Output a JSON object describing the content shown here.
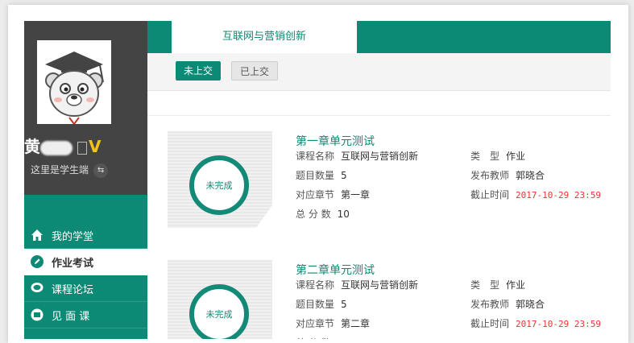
{
  "user": {
    "name_visible": "黄",
    "vip": "V",
    "role_text": "这里是学生端",
    "swap_icon": "switch-icon"
  },
  "nav": [
    {
      "label": "我的学堂",
      "icon": "home-icon"
    },
    {
      "label": "作业考试",
      "icon": "edit-icon",
      "active": true
    },
    {
      "label": "课程论坛",
      "icon": "chat-icon"
    },
    {
      "label": "见 面 课",
      "icon": "meeting-icon"
    }
  ],
  "tab": {
    "label": "互联网与营销创新"
  },
  "filter": {
    "not_submitted": "未上交",
    "submitted": "已上交"
  },
  "colors": {
    "primary": "#0d8a75",
    "sidebar_dark": "#444444",
    "deadline": "#ee3333"
  },
  "labels": {
    "course": "课程名称",
    "count": "题目数量",
    "chapter": "对应章节",
    "score": "总 分 数",
    "type": "类　型",
    "teacher": "发布教师",
    "deadline": "截止时间"
  },
  "cards": [
    {
      "title": "第一章单元测试",
      "status": "未完成",
      "course": "互联网与营销创新",
      "count": "5",
      "chapter": "第一章",
      "score": "10",
      "type": "作业",
      "teacher": "郭晓合",
      "deadline": "2017-10-29 23:59"
    },
    {
      "title": "第二章单元测试",
      "status": "未完成",
      "course": "互联网与营销创新",
      "count": "5",
      "chapter": "第二章",
      "score": "",
      "type": "作业",
      "teacher": "郭晓合",
      "deadline": "2017-10-29 23:59"
    }
  ]
}
